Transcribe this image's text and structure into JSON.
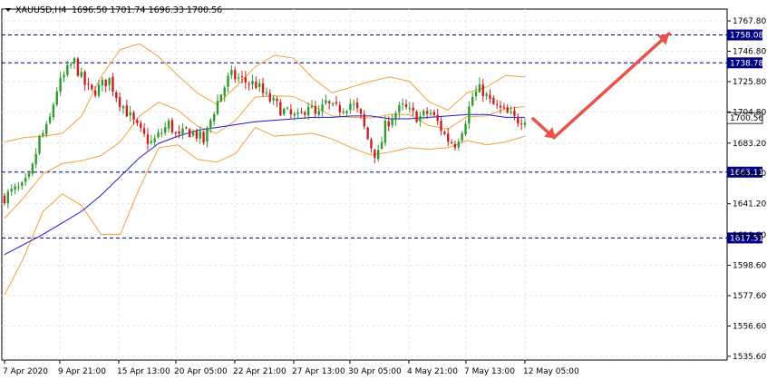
{
  "header": {
    "symbol_timeframe": "XAUUSD,H4",
    "ohlc": "1696.50 1701.74 1696.33 1700.56"
  },
  "colors": {
    "grid": "#e6e6e6",
    "level_line": "#000080",
    "level_label_bg": "#000080",
    "price_label_bg": "#ffffff",
    "bollinger": "#f2a23a",
    "moving_average": "#1a1ad6",
    "candle_up": "#2e9a2e",
    "candle_down": "#cc1f1f",
    "arrow": "#e8524a"
  },
  "chart_data": {
    "type": "candlestick",
    "symbol": "XAUUSD",
    "timeframe": "H4",
    "y_range": [
      1533.0,
      1776.0
    ],
    "y_ticks": [
      "1767.80",
      "1746.80",
      "1725.80",
      "1704.80",
      "1683.20",
      "1662.20",
      "1641.20",
      "1619.60",
      "1598.60",
      "1577.60",
      "1556.60",
      "1535.60"
    ],
    "x_tick_labels": [
      "7 Apr 2020",
      "9 Apr 21:00",
      "15 Apr 13:00",
      "20 Apr 05:00",
      "22 Apr 21:00",
      "27 Apr 13:00",
      "30 Apr 05:00",
      "4 May 21:00",
      "7 May 13:00",
      "12 May 05:00"
    ],
    "current_price": "1700.56",
    "horizontal_levels": [
      "1758.08",
      "1738.78",
      "1663.11",
      "1617.51"
    ],
    "close_path": [
      1646,
      1650,
      1652,
      1660,
      1686,
      1694,
      1720,
      1731,
      1740,
      1726,
      1718,
      1722,
      1728,
      1715,
      1706,
      1696,
      1688,
      1683,
      1690,
      1697,
      1686,
      1692,
      1690,
      1684,
      1704,
      1718,
      1730,
      1728,
      1725,
      1724,
      1716,
      1711,
      1706,
      1702,
      1700,
      1711,
      1700,
      1711,
      1706,
      1708,
      1711,
      1702,
      1684,
      1673,
      1697,
      1704,
      1708,
      1703,
      1701,
      1705,
      1697,
      1686,
      1683,
      1697,
      1716,
      1721,
      1711,
      1707,
      1703,
      1699,
      1701
    ],
    "moving_average_path": [
      1606,
      1613,
      1620,
      1628,
      1636,
      1647,
      1660,
      1673,
      1683,
      1688,
      1692,
      1694,
      1696,
      1698,
      1699,
      1700,
      1701,
      1701,
      1702,
      1702,
      1700,
      1700,
      1701,
      1702,
      1703,
      1703,
      1701,
      1701
    ],
    "bollinger_upper_path": [
      1684,
      1687,
      1688,
      1690,
      1702,
      1729,
      1748,
      1752,
      1743,
      1730,
      1718,
      1710,
      1722,
      1736,
      1744,
      1742,
      1728,
      1718,
      1722,
      1726,
      1729,
      1726,
      1712,
      1706,
      1718,
      1722,
      1730,
      1729
    ],
    "bollinger_lower_path": [
      1578,
      1604,
      1636,
      1648,
      1640,
      1620,
      1620,
      1652,
      1680,
      1682,
      1672,
      1670,
      1676,
      1694,
      1688,
      1689,
      1690,
      1686,
      1680,
      1675,
      1677,
      1680,
      1679,
      1680,
      1685,
      1682,
      1684,
      1688
    ],
    "forecast_arrow": {
      "from_price": 1700.0,
      "via_price": 1687.0,
      "to_price": 1759.0
    }
  }
}
